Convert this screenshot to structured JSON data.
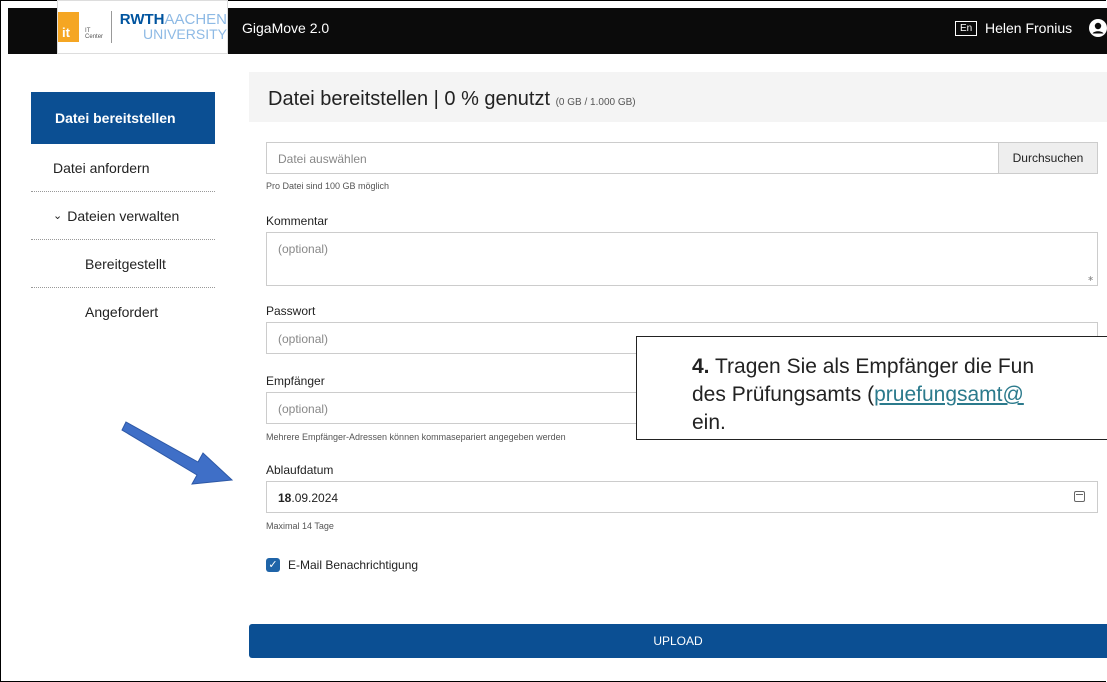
{
  "header": {
    "logo_it": "it",
    "logo_it_sub": "IT Center",
    "logo_rwth": "RWTH",
    "logo_aachen": "AACHEN",
    "logo_university": "UNIVERSITY",
    "app_title": "GigaMove 2.0",
    "lang_button": "En",
    "user_name": "Helen Fronius"
  },
  "sidebar": {
    "items": [
      {
        "label": "Datei bereitstellen"
      },
      {
        "label": "Datei anfordern"
      },
      {
        "label": "Dateien verwalten"
      },
      {
        "label": "Bereitgestellt"
      },
      {
        "label": "Angefordert"
      }
    ]
  },
  "panel": {
    "title": "Datei bereitstellen | 0 % genutzt",
    "usage": "(0 GB / 1.000 GB)"
  },
  "form": {
    "file_placeholder": "Datei auswählen",
    "browse_label": "Durchsuchen",
    "file_hint": "Pro Datei sind 100 GB möglich",
    "comment_label": "Kommentar",
    "comment_placeholder": "(optional)",
    "password_label": "Passwort",
    "password_placeholder": "(optional)",
    "recipient_label": "Empfänger",
    "recipient_placeholder": "(optional)",
    "recipient_hint": "Mehrere Empfänger-Adressen können kommasepariert angegeben werden",
    "expiry_label": "Ablaufdatum",
    "expiry_day": "18",
    "expiry_rest": ".09.2024",
    "expiry_hint": "Maximal 14 Tage",
    "email_notify_label": "E-Mail Benachrichtigung",
    "email_notify_checked": true,
    "upload_label": "UPLOAD"
  },
  "callout": {
    "number": "4.",
    "line1": " Tragen Sie als Empfänger die Fun",
    "line2_start": "des Prüfungsamts (",
    "line2_link": "pruefungsamt@",
    "line3": "ein."
  },
  "colors": {
    "accent": "#0b4f93",
    "topbar": "#0b0b0b",
    "arrow": "#3f6fc7",
    "link": "#2b7a8c"
  }
}
